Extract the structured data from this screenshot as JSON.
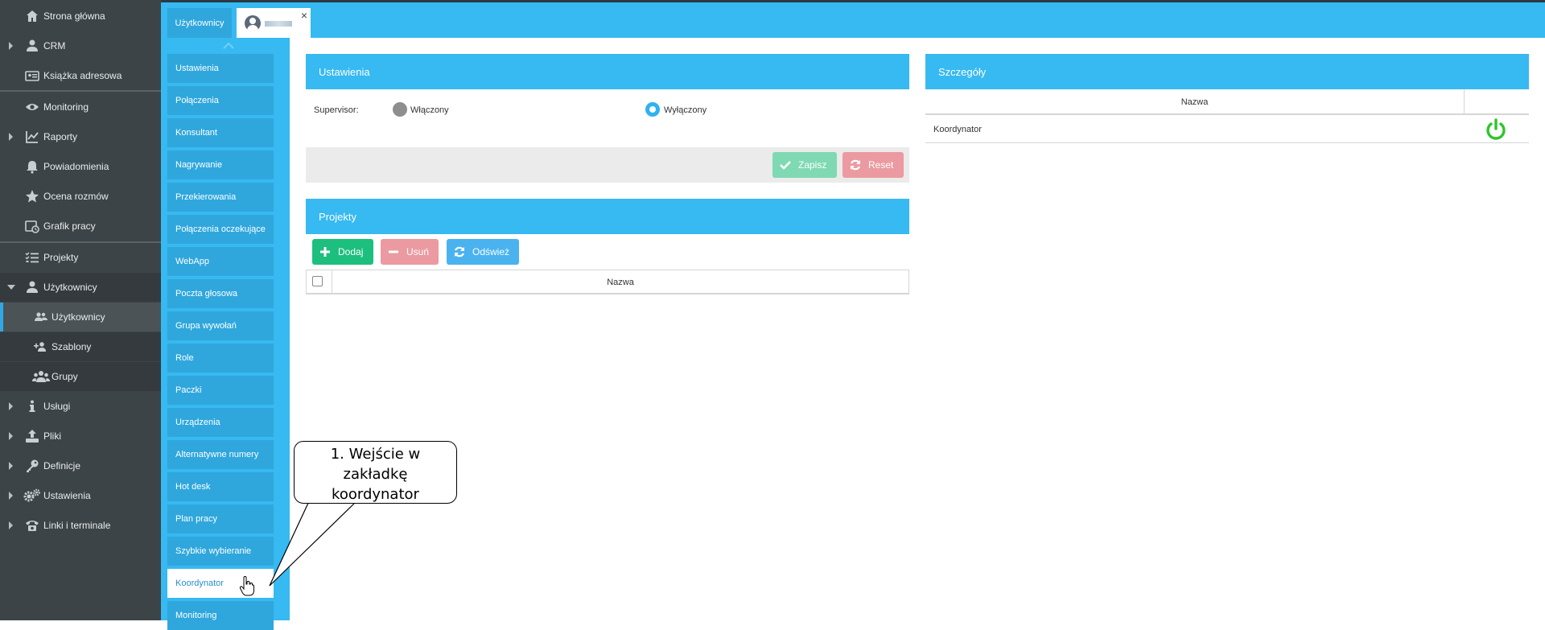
{
  "left_nav": {
    "items": [
      {
        "label": "Strona główna",
        "icon": "home-icon",
        "caret": "none"
      },
      {
        "label": "CRM",
        "icon": "user-icon",
        "caret": "right"
      },
      {
        "label": "Książka adresowa",
        "icon": "address-card-icon",
        "caret": "none"
      },
      {
        "label": "Monitoring",
        "icon": "eye-icon",
        "caret": "none"
      },
      {
        "label": "Raporty",
        "icon": "chart-line-icon",
        "caret": "right"
      },
      {
        "label": "Powiadomienia",
        "icon": "bell-icon",
        "caret": "none"
      },
      {
        "label": "Ocena rozmów",
        "icon": "star-icon",
        "caret": "none"
      },
      {
        "label": "Grafik pracy",
        "icon": "calendar-clock-icon",
        "caret": "none"
      },
      {
        "label": "Projekty",
        "icon": "tasks-icon",
        "caret": "none"
      },
      {
        "label": "Użytkownicy",
        "icon": "user-icon",
        "caret": "down"
      },
      {
        "label": "Użytkownicy",
        "icon": "users-icon",
        "caret": "none"
      },
      {
        "label": "Szablony",
        "icon": "user-plus-icon",
        "caret": "none"
      },
      {
        "label": "Grupy",
        "icon": "group-icon",
        "caret": "none"
      },
      {
        "label": "Usługi",
        "icon": "info-icon",
        "caret": "right"
      },
      {
        "label": "Pliki",
        "icon": "upload-icon",
        "caret": "right"
      },
      {
        "label": "Definicje",
        "icon": "key-icon",
        "caret": "right"
      },
      {
        "label": "Ustawienia",
        "icon": "cogs-icon",
        "caret": "right"
      },
      {
        "label": "Linki i terminale",
        "icon": "phone-icon",
        "caret": "right"
      }
    ]
  },
  "tabs": {
    "users_label": "Użytkownicy",
    "close_glyph": "×"
  },
  "section_menu": {
    "items": [
      "Ustawienia",
      "Połączenia",
      "Konsultant",
      "Nagrywanie",
      "Przekierowania",
      "Połączenia oczekujące",
      "WebApp",
      "Poczta głosowa",
      "Grupa wywołań",
      "Role",
      "Paczki",
      "Urządzenia",
      "Alternatywne numery",
      "Hot desk",
      "Plan pracy",
      "Szybkie wybieranie",
      "Koordynator",
      "Monitoring"
    ],
    "active": "Koordynator"
  },
  "settings_panel": {
    "title": "Ustawienia",
    "supervisor_label": "Supervisor:",
    "option_on": "Włączony",
    "option_off": "Wyłączony",
    "selected": "Wyłączony",
    "save_label": "Zapisz",
    "reset_label": "Reset"
  },
  "projects_panel": {
    "title": "Projekty",
    "add_label": "Dodaj",
    "remove_label": "Usuń",
    "refresh_label": "Odśwież",
    "column_name": "Nazwa"
  },
  "details_panel": {
    "title": "Szczegóły",
    "column_name": "Nazwa",
    "row_name": "Koordynator",
    "row_status": "enabled"
  },
  "callout": {
    "text": "1. Wejście w\nzakładkę\nkoordynator"
  },
  "colors": {
    "nav_bg": "#3d4447",
    "accent": "#37b9f1",
    "menu_item": "#2fa7dd",
    "save_green": "#7fd9b3",
    "reset_red": "#eb9aa1",
    "add_green": "#1dbf7e",
    "refresh_blue": "#4ab3ef",
    "power_green": "#2ec52e"
  }
}
